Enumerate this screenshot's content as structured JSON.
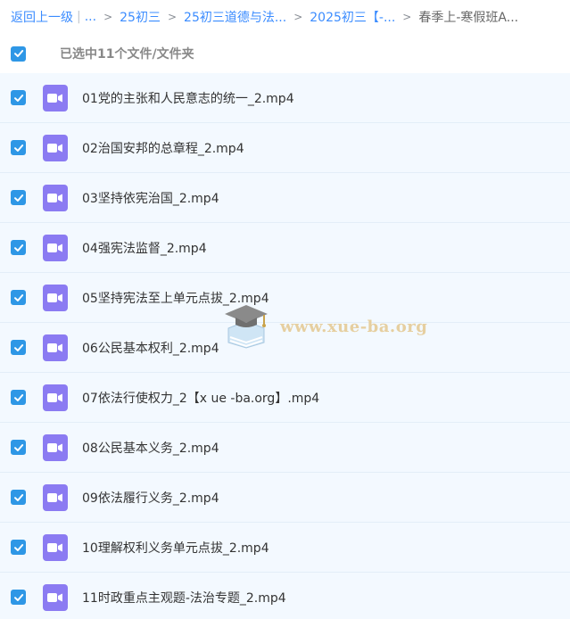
{
  "breadcrumb": {
    "back": "返回上一级",
    "ellipsis": "...",
    "items": [
      "25初三",
      "25初三道德与法...",
      "2025初三【-...",
      "春季上-寒假班A..."
    ]
  },
  "selection": {
    "summary": "已选中11个文件/文件夹"
  },
  "files": [
    {
      "name": "01党的主张和人民意志的统一_2.mp4",
      "checked": true
    },
    {
      "name": "02治国安邦的总章程_2.mp4",
      "checked": true
    },
    {
      "name": "03坚持依宪治国_2.mp4",
      "checked": true
    },
    {
      "name": "04强宪法监督_2.mp4",
      "checked": true
    },
    {
      "name": "05坚持宪法至上单元点拔_2.mp4",
      "checked": true
    },
    {
      "name": "06公民基本权利_2.mp4",
      "checked": true
    },
    {
      "name": "07依法行使权力_2【x ue -ba.org】.mp4",
      "checked": true
    },
    {
      "name": "08公民基本义务_2.mp4",
      "checked": true
    },
    {
      "name": "09依法履行义务_2.mp4",
      "checked": true
    },
    {
      "name": "10理解权利义务单元点拔_2.mp4",
      "checked": true
    },
    {
      "name": "11时政重点主观题-法治专题_2.mp4",
      "checked": true
    }
  ],
  "watermark": {
    "text": "www.xue-ba.org"
  },
  "colors": {
    "link": "#3b8cff",
    "checkbox": "#2e97e6",
    "video_icon": "#8b7bf2",
    "row_bg": "#f3f9ff"
  }
}
